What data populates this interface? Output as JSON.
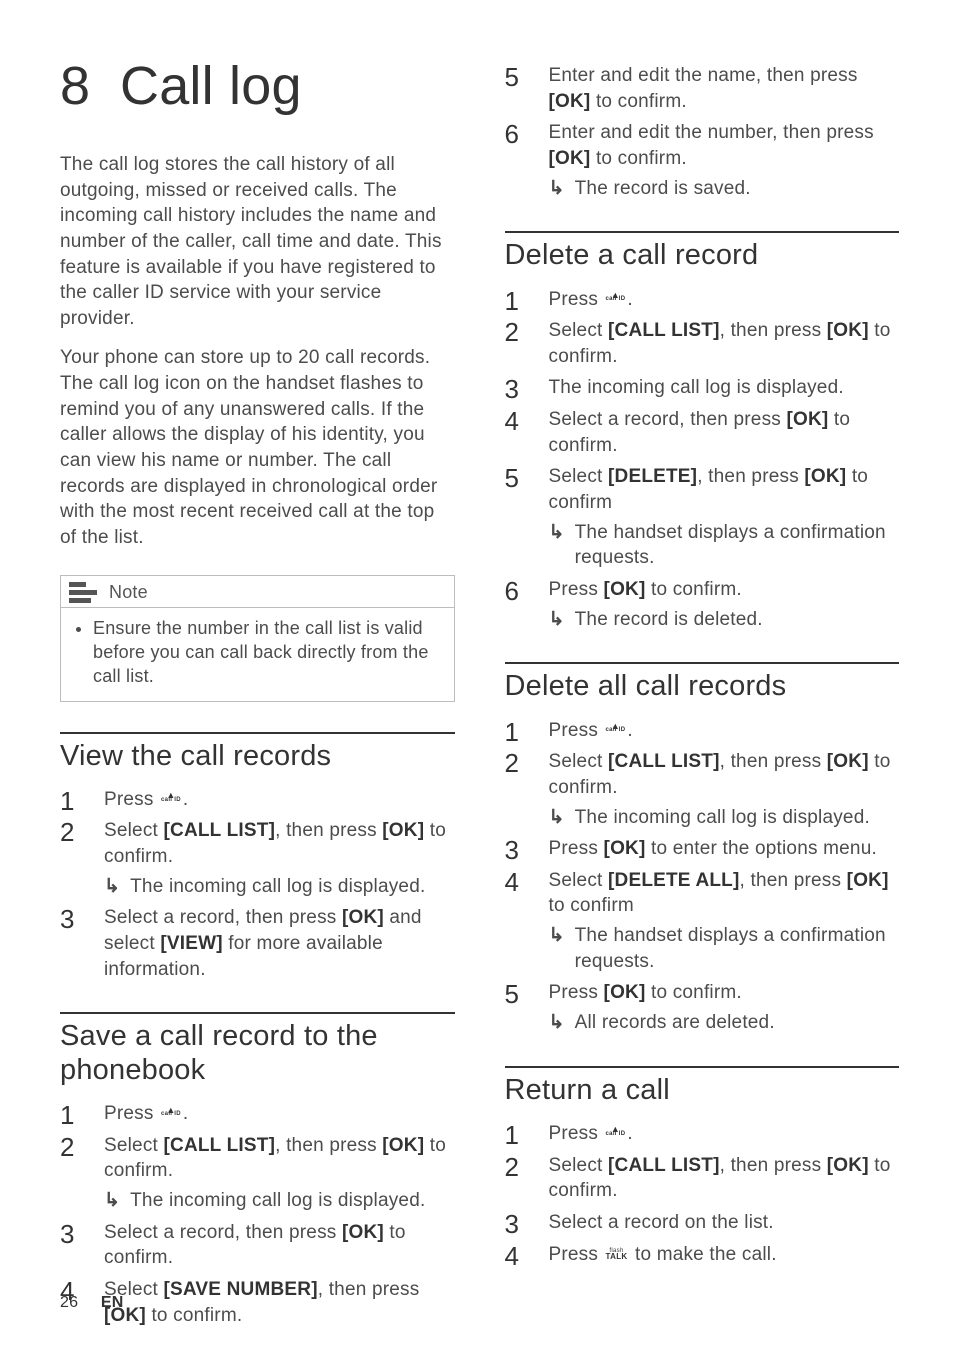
{
  "chapter": {
    "number": "8",
    "title": "Call log"
  },
  "intro": {
    "p1": "The call log stores the call history of all outgoing, missed or received calls. The incoming call history includes the name and number of the caller, call time and date. This feature is available if you have registered to the caller ID service with your service provider.",
    "p2": "Your phone can store up to 20 call records. The call log icon on the handset flashes to remind you of any unanswered calls. If the caller allows the display of his identity, you can view his name or number. The call records are displayed in chronological order with the most recent received call at the top of the list."
  },
  "icons": {
    "callid_label": "call ID",
    "callid_tri": "▲",
    "talk_flash": "flash",
    "talk_label": "TALK"
  },
  "note": {
    "title": "Note",
    "text": "Ensure the number in the call list is valid before you can call back directly from the call list."
  },
  "sections": {
    "view": {
      "title": "View the call records",
      "steps": {
        "s1a": "Press ",
        "s1b": ".",
        "s2a": "Select ",
        "s2b": "[CALL LIST]",
        "s2c": ", then press ",
        "s2d": "[OK]",
        "s2e": " to confirm.",
        "s2_sub": "The incoming call log is displayed.",
        "s3a": "Select a record, then press ",
        "s3b": "[OK]",
        "s3c": " and select ",
        "s3d": "[VIEW]",
        "s3e": " for more available information."
      }
    },
    "save": {
      "title": "Save a call record to the phonebook",
      "steps": {
        "s1a": "Press ",
        "s1b": ".",
        "s2a": "Select ",
        "s2b": "[CALL LIST]",
        "s2c": ", then press ",
        "s2d": "[OK]",
        "s2e": " to confirm.",
        "s2_sub": "The incoming call log is displayed.",
        "s3a": "Select a record, then press ",
        "s3b": "[OK]",
        "s3c": " to confirm.",
        "s4a": "Select ",
        "s4b": "[SAVE NUMBER]",
        "s4c": ", then press ",
        "s4d": "[OK]",
        "s4e": " to confirm.",
        "s5a": "Enter and edit the name, then press ",
        "s5b": "[OK]",
        "s5c": " to confirm.",
        "s6a": "Enter and edit the number, then press ",
        "s6b": "[OK]",
        "s6c": " to confirm.",
        "s6_sub": "The record is saved."
      }
    },
    "delone": {
      "title": "Delete a call record",
      "steps": {
        "s1a": "Press ",
        "s1b": ".",
        "s2a": "Select ",
        "s2b": "[CALL LIST]",
        "s2c": ", then press ",
        "s2d": "[OK]",
        "s2e": " to confirm.",
        "s3": "The incoming call log is displayed.",
        "s4a": "Select a record, then press ",
        "s4b": "[OK]",
        "s4c": " to confirm.",
        "s5a": "Select ",
        "s5b": "[DELETE]",
        "s5c": ", then press ",
        "s5d": "[OK]",
        "s5e": " to confirm",
        "s5_sub": "The handset displays a confirmation requests.",
        "s6a": "Press ",
        "s6b": "[OK]",
        "s6c": " to confirm.",
        "s6_sub": "The record is deleted."
      }
    },
    "delall": {
      "title": "Delete all call records",
      "steps": {
        "s1a": "Press ",
        "s1b": ".",
        "s2a": "Select ",
        "s2b": "[CALL LIST]",
        "s2c": ", then press ",
        "s2d": "[OK]",
        "s2e": " to confirm.",
        "s2_sub": "The incoming call log is displayed.",
        "s3a": "Press ",
        "s3b": "[OK]",
        "s3c": " to enter the options menu.",
        "s4a": "Select ",
        "s4b": "[DELETE ALL]",
        "s4c": ", then press ",
        "s4d": "[OK]",
        "s4e": " to confirm",
        "s4_sub": "The handset displays a confirmation requests.",
        "s5a": "Press ",
        "s5b": "[OK]",
        "s5c": " to confirm.",
        "s5_sub": "All records are deleted."
      }
    },
    "return": {
      "title": "Return a call",
      "steps": {
        "s1a": "Press ",
        "s1b": ".",
        "s2a": "Select ",
        "s2b": "[CALL LIST]",
        "s2c": ", then press ",
        "s2d": "[OK]",
        "s2e": " to confirm.",
        "s3": "Select a record on the list.",
        "s4a": "Press ",
        "s4b": " to make the call."
      }
    }
  },
  "arrow": "↳",
  "footer": {
    "page": "26",
    "lang": "EN"
  }
}
